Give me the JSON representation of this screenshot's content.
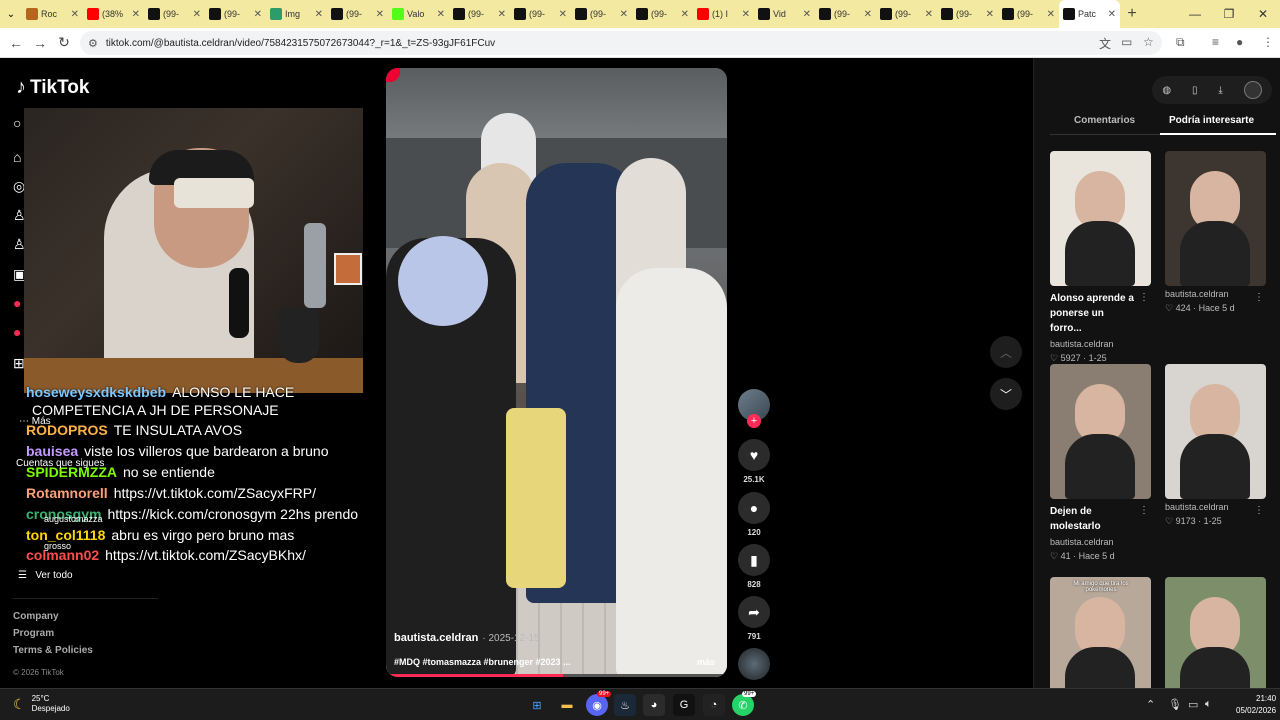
{
  "browser": {
    "tabs": [
      {
        "title": "Roc",
        "icon_color": "#b5651d"
      },
      {
        "title": "(38%",
        "icon_color": "#ff0000"
      },
      {
        "title": "(99-",
        "icon_color": "#111111"
      },
      {
        "title": "(99-",
        "icon_color": "#111111"
      },
      {
        "title": "Img",
        "icon_color": "#2e9c6a"
      },
      {
        "title": "(99-",
        "icon_color": "#111111"
      },
      {
        "title": "Valo",
        "icon_color": "#53fc18"
      },
      {
        "title": "(99-",
        "icon_color": "#111111"
      },
      {
        "title": "(99-",
        "icon_color": "#111111"
      },
      {
        "title": "(99-",
        "icon_color": "#111111"
      },
      {
        "title": "(99-",
        "icon_color": "#111111"
      },
      {
        "title": "(1) I",
        "icon_color": "#ff0000"
      },
      {
        "title": "Vid",
        "icon_color": "#111111"
      },
      {
        "title": "(99-",
        "icon_color": "#111111"
      },
      {
        "title": "(99-",
        "icon_color": "#111111"
      },
      {
        "title": "(99-",
        "icon_color": "#111111"
      },
      {
        "title": "(99-",
        "icon_color": "#111111"
      },
      {
        "title": "Patc",
        "icon_color": "#111111",
        "active": true
      }
    ],
    "new_tab": "+",
    "url": "tiktok.com/@bautista.celdran/video/7584231575072673044?_r=1&_t=ZS-93gJF61FCuv"
  },
  "tiktok": {
    "logo": "TikTok",
    "chat": [
      {
        "user": "hoseweysxdkskdbeb",
        "text": "ALONSO LE HACE",
        "color": "#7cc7ff"
      },
      {
        "user": "",
        "text": "COMPETENCIA A JH DE PERSONAJE",
        "color": "#ffffff"
      },
      {
        "user": "RODOPROS",
        "text": "TE INSULATA AVOS",
        "color": "#ffb347"
      },
      {
        "user": "bauisea",
        "text": "viste los villeros que bardearon a bruno",
        "color": "#c49bff"
      },
      {
        "user": "SPIDERMZZA",
        "text": "no se entiende",
        "color": "#7cfc00"
      },
      {
        "user": "Rotamnorell",
        "text": "https://vt.tiktok.com/ZSacyxFRP/",
        "color": "#ffa07a"
      },
      {
        "user": "cronosgym",
        "text": "https://kick.com/cronosgym 22hs prendo",
        "color": "#3cb371"
      },
      {
        "user": "ton_col1118",
        "text": "abru es virgo pero bruno mas",
        "color": "#ffd700"
      },
      {
        "user": "colmann02",
        "text": "https://vt.tiktok.com/ZSacyBKhx/",
        "color": "#ff4d4d"
      }
    ],
    "sidebar_overlay": {
      "more": "Más",
      "following": "Cuentas que sigues",
      "acc1": "augustomazza",
      "acc2": "grosso",
      "see_all": "Ver todo"
    },
    "footer": {
      "links": [
        "Company",
        "Program",
        "Terms & Policies"
      ],
      "copyright": "© 2026 TikTok"
    },
    "video": {
      "author": "bautista.celdran",
      "date": "· 2025-12-15",
      "description": "#MDQ #tomasmazza #brunenger #2023 ...",
      "more": "más",
      "progress": 0.52
    },
    "actions": {
      "likes": "25.1K",
      "comments": "120",
      "saves": "828",
      "shares": "791"
    },
    "right_panel": {
      "tabs": [
        "Comentarios",
        "Podría interesarte"
      ],
      "cards": [
        {
          "title": "Alonso aprende a ponerse un forro...",
          "author": "bautista.celdran",
          "meta": "♡ 5927 · 1-25",
          "bg": "#e9e4dc"
        },
        {
          "title": "",
          "author": "bautista.celdran",
          "meta": "♡ 424 · Hace 5 d",
          "bg": "#3d3530"
        },
        {
          "title": "Dejen de molestarlo",
          "author": "bautista.celdran",
          "meta": "♡ 41 · Hace 5 d",
          "bg": "#8a7d72"
        },
        {
          "title": "",
          "author": "bautista.celdran",
          "meta": "♡ 9173 · 1-25",
          "bg": "#d8d4cf"
        },
        {
          "title": "",
          "author": "",
          "meta": "",
          "bg": "#b8a89a",
          "caption": "Mi amigo que tira los pokemones"
        },
        {
          "title": "",
          "author": "",
          "meta": "",
          "bg": "#7d8f6a"
        }
      ]
    }
  },
  "taskbar": {
    "weather_temp": "25°C",
    "weather_desc": "Despejado",
    "time": "21:40",
    "date": "05/02/2026",
    "badge1": "99+",
    "badge2": "99+"
  }
}
